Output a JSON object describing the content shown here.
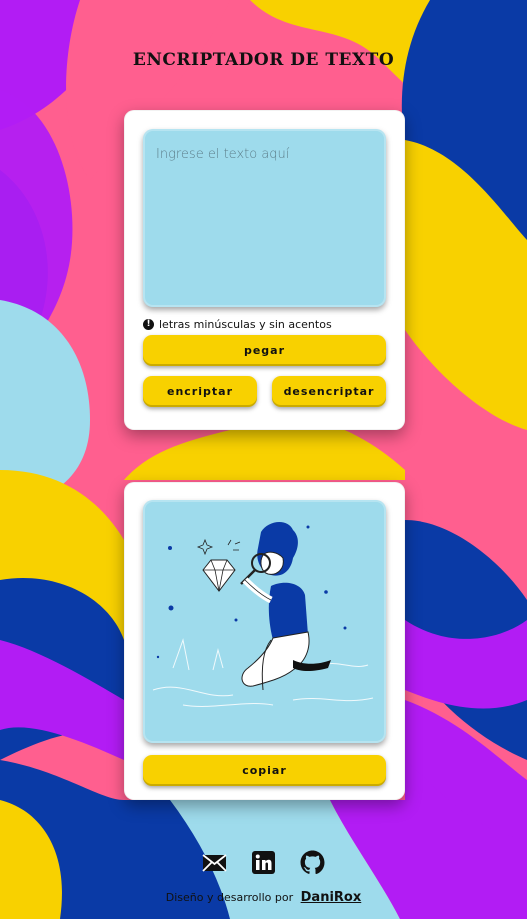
{
  "header": {
    "title": "ENCRIPTADOR DE TEXTO"
  },
  "input": {
    "placeholder": "Ingrese el texto aquí",
    "value": ""
  },
  "note": {
    "icon": "exclamation-circle-icon",
    "text": "letras minúsculas y sin acentos"
  },
  "buttons": {
    "paste": "pegar",
    "encrypt": "encriptar",
    "decrypt": "desencriptar",
    "copy": "copiar"
  },
  "social": {
    "items": [
      "mail-icon",
      "linkedin-icon",
      "github-icon"
    ]
  },
  "footer": {
    "text": "Diseño y desarrollo por",
    "author": "DaniRox"
  },
  "colors": {
    "yellow": "#f8d100",
    "panel": "#9edbec",
    "pink": "#ff5f8f",
    "purple": "#b21cf4",
    "navy": "#0a3aa6",
    "sky": "#9edbec"
  }
}
